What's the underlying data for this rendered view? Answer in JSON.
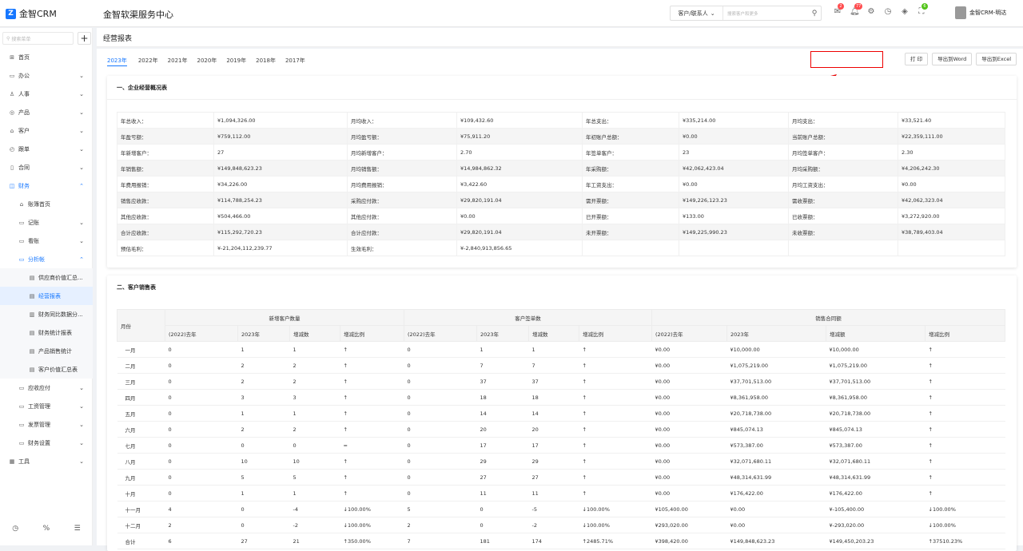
{
  "app": {
    "logo": "金智CRM",
    "system_title": "金智软渠服务中心"
  },
  "search": {
    "type_label": "客户/联系人",
    "placeholder": "搜索客户和更多"
  },
  "badges": {
    "mail": "2",
    "bell": "77",
    "gift": "6"
  },
  "user": {
    "name": "金智CRM-明达"
  },
  "sidebar": {
    "search_placeholder": "搜索菜单",
    "items": [
      {
        "label": "首页",
        "icon": "home-icon",
        "chev": ""
      },
      {
        "label": "办公",
        "icon": "office-icon",
        "chev": "⌄"
      },
      {
        "label": "人事",
        "icon": "people-icon",
        "chev": "⌄"
      },
      {
        "label": "产品",
        "icon": "product-icon",
        "chev": "⌄"
      },
      {
        "label": "客户",
        "icon": "customer-icon",
        "chev": "⌄"
      },
      {
        "label": "跟单",
        "icon": "follow-icon",
        "chev": "⌄"
      },
      {
        "label": "合同",
        "icon": "contract-icon",
        "chev": "⌄"
      },
      {
        "label": "财务",
        "icon": "finance-icon",
        "chev": "⌃"
      },
      {
        "label": "账簿首页",
        "icon": "book-icon",
        "chev": ""
      },
      {
        "label": "记账",
        "icon": "record-icon",
        "chev": "⌄"
      },
      {
        "label": "看账",
        "icon": "view-icon",
        "chev": "⌄"
      },
      {
        "label": "分析帐",
        "icon": "analysis-icon",
        "chev": "⌃"
      },
      {
        "label": "供应商价值汇总...",
        "icon": "doc-icon",
        "chev": ""
      },
      {
        "label": "经营报表",
        "icon": "doc-icon",
        "chev": ""
      },
      {
        "label": "财务同比数据分...",
        "icon": "chart-icon",
        "chev": ""
      },
      {
        "label": "财务统计报表",
        "icon": "doc-icon",
        "chev": ""
      },
      {
        "label": "产品销售统计",
        "icon": "doc-icon",
        "chev": ""
      },
      {
        "label": "客户价值汇总表",
        "icon": "doc-icon",
        "chev": ""
      },
      {
        "label": "应收应付",
        "icon": "receivable-icon",
        "chev": "⌄"
      },
      {
        "label": "工资管理",
        "icon": "salary-icon",
        "chev": "⌄"
      },
      {
        "label": "发票管理",
        "icon": "invoice-icon",
        "chev": "⌄"
      },
      {
        "label": "财务设置",
        "icon": "settings-icon",
        "chev": "⌄"
      },
      {
        "label": "工具",
        "icon": "tool-icon",
        "chev": "⌄"
      }
    ]
  },
  "page": {
    "title": "经营报表"
  },
  "tabs": [
    "2023年",
    "2022年",
    "2021年",
    "2020年",
    "2019年",
    "2018年",
    "2017年"
  ],
  "buttons": {
    "print": "打 印",
    "word": "导出到Word",
    "excel": "导出到Excel"
  },
  "summary": {
    "title": "一、企业经营概况表",
    "rows": [
      [
        "年总收入：",
        "¥1,094,326.00",
        "月均收入：",
        "¥109,432.60",
        "年总支出：",
        "¥335,214.00",
        "月均支出：",
        "¥33,521.40"
      ],
      [
        "年盈亏额：",
        "¥759,112.00",
        "月均盈亏额：",
        "¥75,911.20",
        "年初账户总额：",
        "¥0.00",
        "当前账户总额：",
        "¥22,359,111.00"
      ],
      [
        "年新增客户：",
        "27",
        "月均新增客户：",
        "2.70",
        "年签单客户：",
        "23",
        "月均签单客户：",
        "2.30"
      ],
      [
        "年销售额：",
        "¥149,848,623.23",
        "月均销售额：",
        "¥14,984,862.32",
        "年采购额：",
        "¥42,062,423.04",
        "月均采购额：",
        "¥4,206,242.30"
      ],
      [
        "年费用报销：",
        "¥34,226.00",
        "月均费用报销：",
        "¥3,422.60",
        "年工资支出：",
        "¥0.00",
        "月均工资支出：",
        "¥0.00"
      ],
      [
        "销售应收款：",
        "¥114,788,254.23",
        "采购应付款：",
        "¥29,820,191.04",
        "需开票额：",
        "¥149,226,123.23",
        "需收票额：",
        "¥42,062,323.04"
      ],
      [
        "其他应收款：",
        "¥504,466.00",
        "其他应付款：",
        "¥0.00",
        "已开票额：",
        "¥133.00",
        "已收票额：",
        "¥3,272,920.00"
      ],
      [
        "合计应收款：",
        "¥115,292,720.23",
        "合计应付款：",
        "¥29,820,191.04",
        "未开票额：",
        "¥149,225,990.23",
        "未收票额：",
        "¥38,789,403.04"
      ],
      [
        "预估毛利：",
        "¥-21,204,112,239.77",
        "生效毛利：",
        "¥-2,840,913,856.65",
        "",
        "",
        "",
        ""
      ]
    ]
  },
  "sales": {
    "title": "二、客户销售表",
    "month_header": "月份",
    "groups": [
      "新增客户数量",
      "客户签单数",
      "销售合同额"
    ],
    "sub_headers": [
      "(2022)去年",
      "2023年",
      "增减数",
      "增减比例",
      "(2022)去年",
      "2023年",
      "增减数",
      "增减比例",
      "(2022)去年",
      "2023年",
      "增减额",
      "增减比例"
    ],
    "rows": [
      [
        "一月",
        "0",
        "1",
        "1",
        "↑",
        "0",
        "1",
        "1",
        "↑",
        "¥0.00",
        "¥10,000.00",
        "¥10,000.00",
        "↑"
      ],
      [
        "二月",
        "0",
        "2",
        "2",
        "↑",
        "0",
        "7",
        "7",
        "↑",
        "¥0.00",
        "¥1,075,219.00",
        "¥1,075,219.00",
        "↑"
      ],
      [
        "三月",
        "0",
        "2",
        "2",
        "↑",
        "0",
        "37",
        "37",
        "↑",
        "¥0.00",
        "¥37,701,513.00",
        "¥37,701,513.00",
        "↑"
      ],
      [
        "四月",
        "0",
        "3",
        "3",
        "↑",
        "0",
        "18",
        "18",
        "↑",
        "¥0.00",
        "¥8,361,958.00",
        "¥8,361,958.00",
        "↑"
      ],
      [
        "五月",
        "0",
        "1",
        "1",
        "↑",
        "0",
        "14",
        "14",
        "↑",
        "¥0.00",
        "¥20,718,738.00",
        "¥20,718,738.00",
        "↑"
      ],
      [
        "六月",
        "0",
        "2",
        "2",
        "↑",
        "0",
        "20",
        "20",
        "↑",
        "¥0.00",
        "¥845,074.13",
        "¥845,074.13",
        "↑"
      ],
      [
        "七月",
        "0",
        "0",
        "0",
        "=",
        "0",
        "17",
        "17",
        "↑",
        "¥0.00",
        "¥573,387.00",
        "¥573,387.00",
        "↑"
      ],
      [
        "八月",
        "0",
        "10",
        "10",
        "↑",
        "0",
        "29",
        "29",
        "↑",
        "¥0.00",
        "¥32,071,680.11",
        "¥32,071,680.11",
        "↑"
      ],
      [
        "九月",
        "0",
        "5",
        "5",
        "↑",
        "0",
        "27",
        "27",
        "↑",
        "¥0.00",
        "¥48,314,631.99",
        "¥48,314,631.99",
        "↑"
      ],
      [
        "十月",
        "0",
        "1",
        "1",
        "↑",
        "0",
        "11",
        "11",
        "↑",
        "¥0.00",
        "¥176,422.00",
        "¥176,422.00",
        "↑"
      ],
      [
        "十一月",
        "4",
        "0",
        "-4",
        "↓100.00%",
        "5",
        "0",
        "-5",
        "↓100.00%",
        "¥105,400.00",
        "¥0.00",
        "¥-105,400.00",
        "↓100.00%"
      ],
      [
        "十二月",
        "2",
        "0",
        "-2",
        "↓100.00%",
        "2",
        "0",
        "-2",
        "↓100.00%",
        "¥293,020.00",
        "¥0.00",
        "¥-293,020.00",
        "↓100.00%"
      ],
      [
        "合计",
        "6",
        "27",
        "21",
        "↑350.00%",
        "7",
        "181",
        "174",
        "↑2485.71%",
        "¥398,420.00",
        "¥149,848,623.23",
        "¥149,450,203.23",
        "↑37510.23%"
      ]
    ]
  }
}
